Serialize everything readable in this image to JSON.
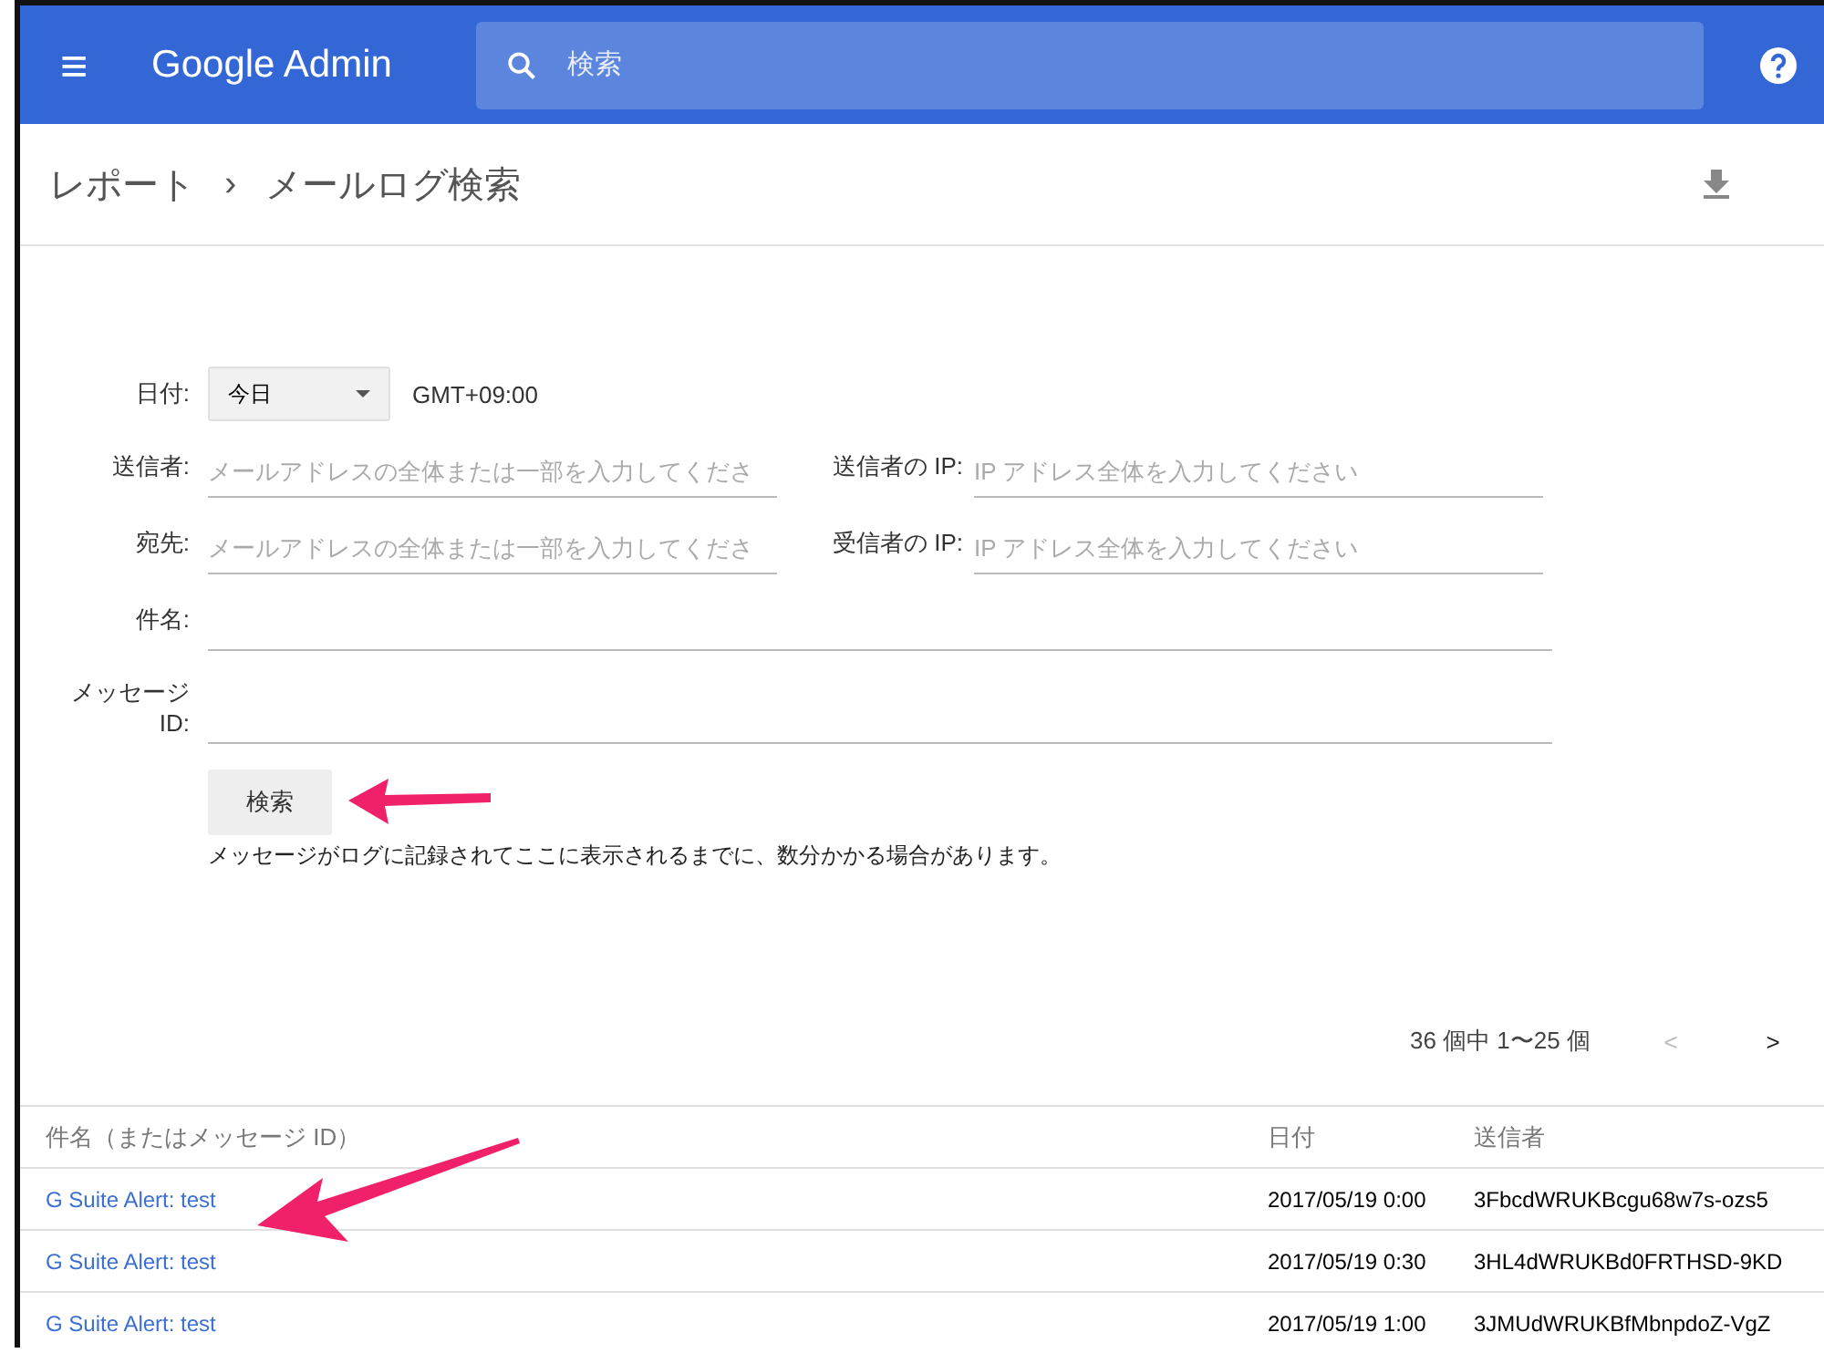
{
  "header": {
    "menu_icon": "≡",
    "product": "Google Admin",
    "search": {
      "placeholder": "検索"
    }
  },
  "breadcrumb": {
    "items": [
      "レポート",
      "メールログ検索"
    ],
    "separator": "›"
  },
  "form": {
    "date": {
      "label": "日付:",
      "value": "今日",
      "timezone": "GMT+09:00"
    },
    "rows": [
      [
        {
          "label": "送信者:",
          "placeholder": "メールアドレスの全体または一部を入力してくださ"
        },
        {
          "label": "送信者の IP:",
          "placeholder": "IP アドレス全体を入力してください"
        }
      ],
      [
        {
          "label": "宛先:",
          "placeholder": "メールアドレスの全体または一部を入力してくださ"
        },
        {
          "label": "受信者の IP:",
          "placeholder": "IP アドレス全体を入力してください"
        }
      ]
    ],
    "wide_fields": [
      {
        "label": "件名:"
      },
      {
        "label": "メッセージ ID:"
      }
    ],
    "search_button": "検索",
    "note": "メッセージがログに記録されてここに表示されるまでに、数分かかる場合があります。"
  },
  "pagination": {
    "range": "36 個中 1〜25 個",
    "prev": "<",
    "next": ">",
    "prev_disabled": true
  },
  "table": {
    "columns": [
      "件名（またはメッセージ ID）",
      "日付",
      "送信者"
    ],
    "rows": [
      {
        "subject": "G Suite Alert: test",
        "date": "2017/05/19 0:00",
        "sender": "3FbcdWRUKBcgu68w7s-ozs5"
      },
      {
        "subject": "G Suite Alert: test",
        "date": "2017/05/19 0:30",
        "sender": "3HL4dWRUKBd0FRTHSD-9KD"
      },
      {
        "subject": "G Suite Alert: test",
        "date": "2017/05/19 1:00",
        "sender": "3JMUdWRUKBfMbnpdoZ-VgZ"
      }
    ]
  }
}
